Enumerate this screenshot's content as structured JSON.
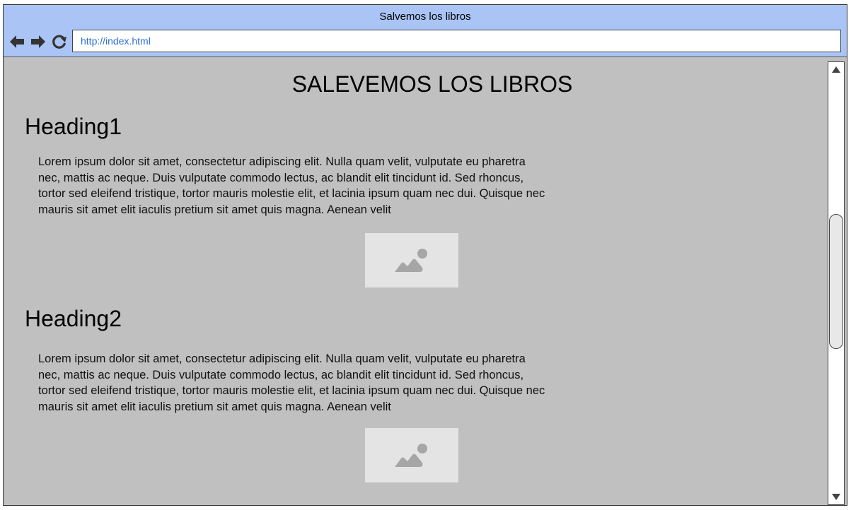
{
  "window": {
    "title": "Salvemos los libros"
  },
  "toolbar": {
    "back_icon": "arrow-left-icon",
    "forward_icon": "arrow-right-icon",
    "reload_icon": "reload-icon",
    "url": "http://index.html"
  },
  "page": {
    "title": "SALEVEMOS LOS LIBROS",
    "sections": [
      {
        "heading": "Heading1",
        "body": "Lorem ipsum dolor sit amet, consectetur adipiscing elit. Nulla quam velit, vulputate eu pharetra nec, mattis ac neque. Duis vulputate commodo lectus, ac blandit elit tincidunt id. Sed rhoncus, tortor sed eleifend tristique, tortor mauris molestie elit, et lacinia ipsum quam nec dui. Quisque nec mauris sit amet elit iaculis pretium sit amet quis magna. Aenean velit",
        "image_icon": "image-placeholder-icon"
      },
      {
        "heading": "Heading2",
        "body": "Lorem ipsum dolor sit amet, consectetur adipiscing elit. Nulla quam velit, vulputate eu pharetra nec, mattis ac neque. Duis vulputate commodo lectus, ac blandit elit tincidunt id. Sed rhoncus, tortor sed eleifend tristique, tortor mauris molestie elit, et lacinia ipsum quam nec dui. Quisque nec mauris sit amet elit iaculis pretium sit amet quis magna. Aenean velit",
        "image_icon": "image-placeholder-icon"
      }
    ]
  },
  "colors": {
    "chrome": "#a9c4f5",
    "page_background": "#c0c0c0",
    "url_text": "#2a6fd6",
    "placeholder": "#e4e4e4"
  }
}
